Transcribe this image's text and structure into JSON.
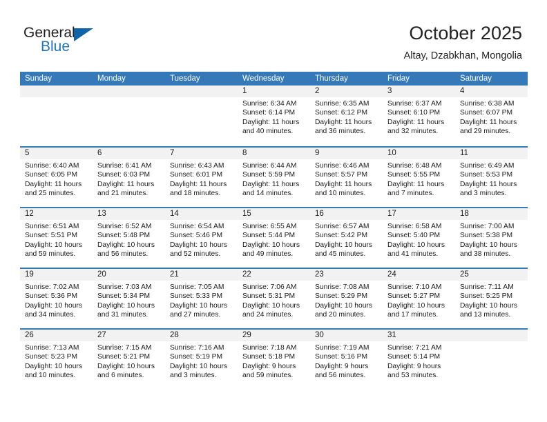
{
  "brand": {
    "name_part1": "General",
    "name_part2": "Blue",
    "triangle_color": "#1065a8",
    "blue_color": "#1f74bd"
  },
  "header": {
    "title": "October 2025",
    "subtitle": "Altay, Dzabkhan, Mongolia"
  },
  "theme": {
    "header_blue": "#3579b9",
    "day_band_gray": "#f2f2f2",
    "text": "#1a1a1a"
  },
  "weekdays": [
    "Sunday",
    "Monday",
    "Tuesday",
    "Wednesday",
    "Thursday",
    "Friday",
    "Saturday"
  ],
  "weeks": [
    [
      {
        "day": "",
        "sunrise": "",
        "sunset": "",
        "daylight_line1": "",
        "daylight_line2": ""
      },
      {
        "day": "",
        "sunrise": "",
        "sunset": "",
        "daylight_line1": "",
        "daylight_line2": ""
      },
      {
        "day": "",
        "sunrise": "",
        "sunset": "",
        "daylight_line1": "",
        "daylight_line2": ""
      },
      {
        "day": "1",
        "sunrise": "Sunrise: 6:34 AM",
        "sunset": "Sunset: 6:14 PM",
        "daylight_line1": "Daylight: 11 hours",
        "daylight_line2": "and 40 minutes."
      },
      {
        "day": "2",
        "sunrise": "Sunrise: 6:35 AM",
        "sunset": "Sunset: 6:12 PM",
        "daylight_line1": "Daylight: 11 hours",
        "daylight_line2": "and 36 minutes."
      },
      {
        "day": "3",
        "sunrise": "Sunrise: 6:37 AM",
        "sunset": "Sunset: 6:10 PM",
        "daylight_line1": "Daylight: 11 hours",
        "daylight_line2": "and 32 minutes."
      },
      {
        "day": "4",
        "sunrise": "Sunrise: 6:38 AM",
        "sunset": "Sunset: 6:07 PM",
        "daylight_line1": "Daylight: 11 hours",
        "daylight_line2": "and 29 minutes."
      }
    ],
    [
      {
        "day": "5",
        "sunrise": "Sunrise: 6:40 AM",
        "sunset": "Sunset: 6:05 PM",
        "daylight_line1": "Daylight: 11 hours",
        "daylight_line2": "and 25 minutes."
      },
      {
        "day": "6",
        "sunrise": "Sunrise: 6:41 AM",
        "sunset": "Sunset: 6:03 PM",
        "daylight_line1": "Daylight: 11 hours",
        "daylight_line2": "and 21 minutes."
      },
      {
        "day": "7",
        "sunrise": "Sunrise: 6:43 AM",
        "sunset": "Sunset: 6:01 PM",
        "daylight_line1": "Daylight: 11 hours",
        "daylight_line2": "and 18 minutes."
      },
      {
        "day": "8",
        "sunrise": "Sunrise: 6:44 AM",
        "sunset": "Sunset: 5:59 PM",
        "daylight_line1": "Daylight: 11 hours",
        "daylight_line2": "and 14 minutes."
      },
      {
        "day": "9",
        "sunrise": "Sunrise: 6:46 AM",
        "sunset": "Sunset: 5:57 PM",
        "daylight_line1": "Daylight: 11 hours",
        "daylight_line2": "and 10 minutes."
      },
      {
        "day": "10",
        "sunrise": "Sunrise: 6:48 AM",
        "sunset": "Sunset: 5:55 PM",
        "daylight_line1": "Daylight: 11 hours",
        "daylight_line2": "and 7 minutes."
      },
      {
        "day": "11",
        "sunrise": "Sunrise: 6:49 AM",
        "sunset": "Sunset: 5:53 PM",
        "daylight_line1": "Daylight: 11 hours",
        "daylight_line2": "and 3 minutes."
      }
    ],
    [
      {
        "day": "12",
        "sunrise": "Sunrise: 6:51 AM",
        "sunset": "Sunset: 5:51 PM",
        "daylight_line1": "Daylight: 10 hours",
        "daylight_line2": "and 59 minutes."
      },
      {
        "day": "13",
        "sunrise": "Sunrise: 6:52 AM",
        "sunset": "Sunset: 5:48 PM",
        "daylight_line1": "Daylight: 10 hours",
        "daylight_line2": "and 56 minutes."
      },
      {
        "day": "14",
        "sunrise": "Sunrise: 6:54 AM",
        "sunset": "Sunset: 5:46 PM",
        "daylight_line1": "Daylight: 10 hours",
        "daylight_line2": "and 52 minutes."
      },
      {
        "day": "15",
        "sunrise": "Sunrise: 6:55 AM",
        "sunset": "Sunset: 5:44 PM",
        "daylight_line1": "Daylight: 10 hours",
        "daylight_line2": "and 49 minutes."
      },
      {
        "day": "16",
        "sunrise": "Sunrise: 6:57 AM",
        "sunset": "Sunset: 5:42 PM",
        "daylight_line1": "Daylight: 10 hours",
        "daylight_line2": "and 45 minutes."
      },
      {
        "day": "17",
        "sunrise": "Sunrise: 6:58 AM",
        "sunset": "Sunset: 5:40 PM",
        "daylight_line1": "Daylight: 10 hours",
        "daylight_line2": "and 41 minutes."
      },
      {
        "day": "18",
        "sunrise": "Sunrise: 7:00 AM",
        "sunset": "Sunset: 5:38 PM",
        "daylight_line1": "Daylight: 10 hours",
        "daylight_line2": "and 38 minutes."
      }
    ],
    [
      {
        "day": "19",
        "sunrise": "Sunrise: 7:02 AM",
        "sunset": "Sunset: 5:36 PM",
        "daylight_line1": "Daylight: 10 hours",
        "daylight_line2": "and 34 minutes."
      },
      {
        "day": "20",
        "sunrise": "Sunrise: 7:03 AM",
        "sunset": "Sunset: 5:34 PM",
        "daylight_line1": "Daylight: 10 hours",
        "daylight_line2": "and 31 minutes."
      },
      {
        "day": "21",
        "sunrise": "Sunrise: 7:05 AM",
        "sunset": "Sunset: 5:33 PM",
        "daylight_line1": "Daylight: 10 hours",
        "daylight_line2": "and 27 minutes."
      },
      {
        "day": "22",
        "sunrise": "Sunrise: 7:06 AM",
        "sunset": "Sunset: 5:31 PM",
        "daylight_line1": "Daylight: 10 hours",
        "daylight_line2": "and 24 minutes."
      },
      {
        "day": "23",
        "sunrise": "Sunrise: 7:08 AM",
        "sunset": "Sunset: 5:29 PM",
        "daylight_line1": "Daylight: 10 hours",
        "daylight_line2": "and 20 minutes."
      },
      {
        "day": "24",
        "sunrise": "Sunrise: 7:10 AM",
        "sunset": "Sunset: 5:27 PM",
        "daylight_line1": "Daylight: 10 hours",
        "daylight_line2": "and 17 minutes."
      },
      {
        "day": "25",
        "sunrise": "Sunrise: 7:11 AM",
        "sunset": "Sunset: 5:25 PM",
        "daylight_line1": "Daylight: 10 hours",
        "daylight_line2": "and 13 minutes."
      }
    ],
    [
      {
        "day": "26",
        "sunrise": "Sunrise: 7:13 AM",
        "sunset": "Sunset: 5:23 PM",
        "daylight_line1": "Daylight: 10 hours",
        "daylight_line2": "and 10 minutes."
      },
      {
        "day": "27",
        "sunrise": "Sunrise: 7:15 AM",
        "sunset": "Sunset: 5:21 PM",
        "daylight_line1": "Daylight: 10 hours",
        "daylight_line2": "and 6 minutes."
      },
      {
        "day": "28",
        "sunrise": "Sunrise: 7:16 AM",
        "sunset": "Sunset: 5:19 PM",
        "daylight_line1": "Daylight: 10 hours",
        "daylight_line2": "and 3 minutes."
      },
      {
        "day": "29",
        "sunrise": "Sunrise: 7:18 AM",
        "sunset": "Sunset: 5:18 PM",
        "daylight_line1": "Daylight: 9 hours",
        "daylight_line2": "and 59 minutes."
      },
      {
        "day": "30",
        "sunrise": "Sunrise: 7:19 AM",
        "sunset": "Sunset: 5:16 PM",
        "daylight_line1": "Daylight: 9 hours",
        "daylight_line2": "and 56 minutes."
      },
      {
        "day": "31",
        "sunrise": "Sunrise: 7:21 AM",
        "sunset": "Sunset: 5:14 PM",
        "daylight_line1": "Daylight: 9 hours",
        "daylight_line2": "and 53 minutes."
      },
      {
        "day": "",
        "sunrise": "",
        "sunset": "",
        "daylight_line1": "",
        "daylight_line2": ""
      }
    ]
  ]
}
